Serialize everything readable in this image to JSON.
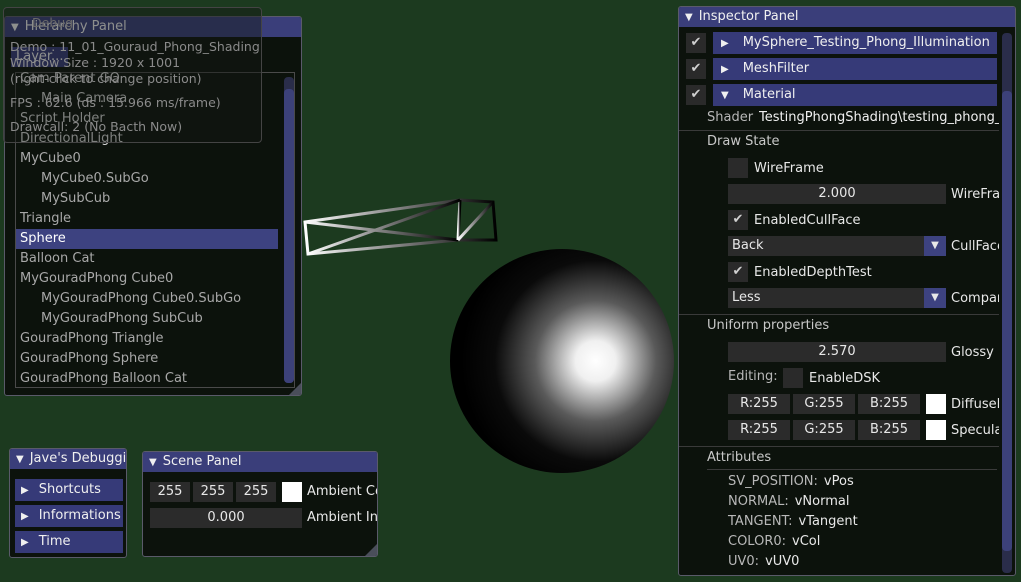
{
  "debug_overlay": {
    "title": "Debug",
    "demo": "Demo : 11_01_Gouraud_Phong_Shading",
    "window_size": "Window Size : 1920 x 1001",
    "hint": "(right-click to change position)",
    "fps": "FPS : 62.6 (ds : 15.966 ms/frame)",
    "drawcall": "Drawcall: 2 (No Bacth Now)"
  },
  "hierarchy": {
    "title": "Hierarchy Panel",
    "layer_button": "Layer...",
    "items": [
      {
        "label": "Cam Parent GO",
        "indent": 0,
        "selected": false
      },
      {
        "label": "Main Camera",
        "indent": 1,
        "selected": false
      },
      {
        "label": "Script Holder",
        "indent": 0,
        "selected": false
      },
      {
        "label": "DirectionalLight",
        "indent": 0,
        "selected": false
      },
      {
        "label": "MyCube0",
        "indent": 0,
        "selected": false
      },
      {
        "label": "MyCube0.SubGo",
        "indent": 1,
        "selected": false
      },
      {
        "label": "MySubCub",
        "indent": 1,
        "selected": false
      },
      {
        "label": "Triangle",
        "indent": 0,
        "selected": false
      },
      {
        "label": "Sphere",
        "indent": 0,
        "selected": true
      },
      {
        "label": "Balloon Cat",
        "indent": 0,
        "selected": false
      },
      {
        "label": "MyGouradPhong Cube0",
        "indent": 0,
        "selected": false
      },
      {
        "label": "MyGouradPhong Cube0.SubGo",
        "indent": 1,
        "selected": false
      },
      {
        "label": "MyGouradPhong SubCub",
        "indent": 1,
        "selected": false
      },
      {
        "label": "GouradPhong Triangle",
        "indent": 0,
        "selected": false
      },
      {
        "label": "GouradPhong Sphere",
        "indent": 0,
        "selected": false
      },
      {
        "label": "GouradPhong Balloon Cat",
        "indent": 0,
        "selected": false
      }
    ]
  },
  "debugging": {
    "title": "Jave's Debugging",
    "items": [
      "Shortcuts",
      "Informations",
      "Time"
    ]
  },
  "scene": {
    "title": "Scene Panel",
    "ambient_rgb": [
      "255",
      "255",
      "255"
    ],
    "ambient_color_label": "Ambient Color",
    "ambient_intensity": "0.000",
    "ambient_intensity_label": "Ambient Intensity"
  },
  "inspector": {
    "title": "Inspector Panel",
    "components": [
      {
        "label": "MySphere_Testing_Phong_Illumination",
        "expanded": false
      },
      {
        "label": "MeshFilter",
        "expanded": false
      },
      {
        "label": "Material",
        "expanded": true
      }
    ],
    "shader_label": "Shader",
    "shader_value": "TestingPhongShading\\testing_phong_c",
    "draw_state_label": "Draw State",
    "wireframe_label": "WireFrame",
    "wireframe_width": "2.000",
    "wireframe_width_label": "WireFrame Width",
    "cullface_label": "EnabledCullFace",
    "cullface_value": "Back",
    "cullface_combo_label": "CullFace",
    "depthtest_label": "EnabledDepthTest",
    "depth_value": "Less",
    "depth_combo_label": "Compare",
    "uniform_label": "Uniform properties",
    "glossy_value": "2.570",
    "glossy_label": "Glossy",
    "editing_label": "Editing:",
    "enable_dsk_label": "EnableDSK",
    "diffuse": {
      "r": "R:255",
      "g": "G:255",
      "b": "B:255",
      "label": "DiffuseL"
    },
    "specular": {
      "r": "R:255",
      "g": "G:255",
      "b": "B:255",
      "label": "Specular"
    },
    "attributes_label": "Attributes",
    "attributes": [
      {
        "name": "SV_POSITION:",
        "value": "vPos"
      },
      {
        "name": "NORMAL:",
        "value": "vNormal"
      },
      {
        "name": "TANGENT:",
        "value": "vTangent"
      },
      {
        "name": "COLOR0:",
        "value": "vCol"
      },
      {
        "name": "UV0:",
        "value": "vUV0"
      }
    ]
  },
  "colors": {
    "background": "#1c3a1f",
    "titlebar": "#3a3e7a",
    "selected": "#3d4280",
    "swatch": "#ffffff"
  }
}
